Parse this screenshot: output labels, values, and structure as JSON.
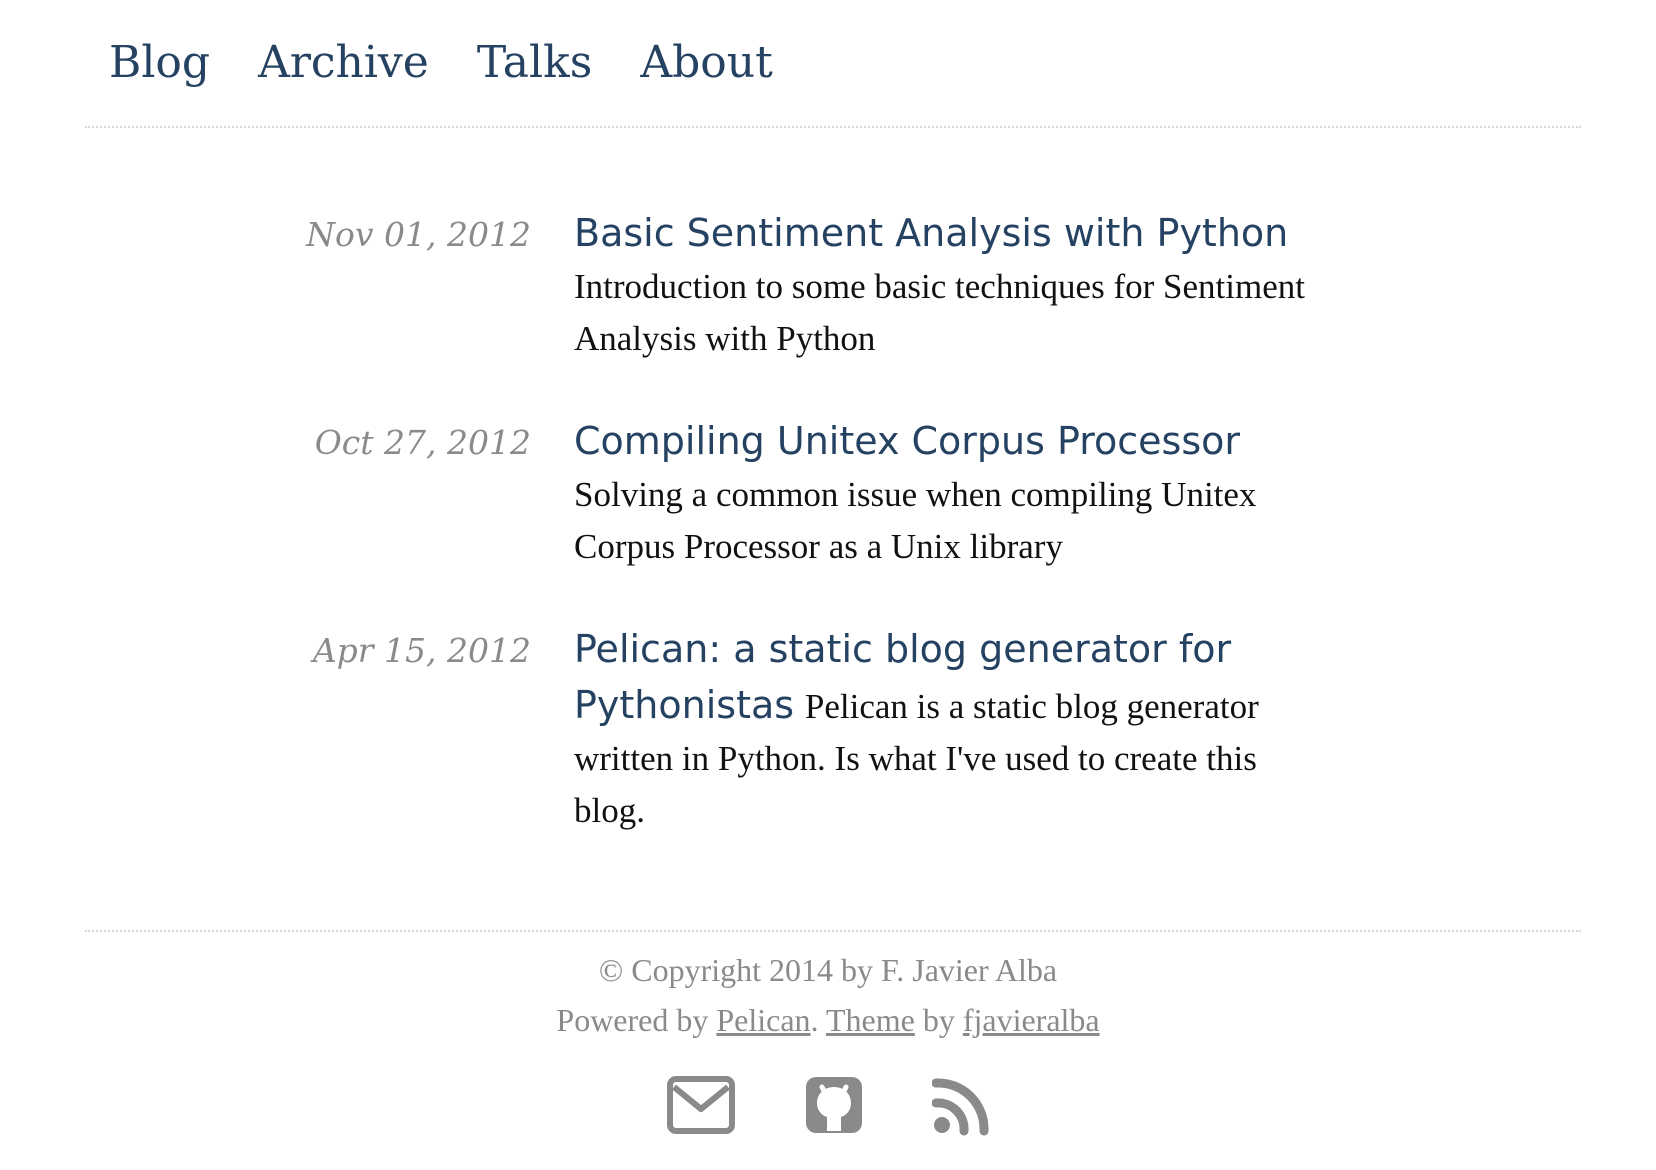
{
  "nav": {
    "items": [
      {
        "label": "Blog"
      },
      {
        "label": "Archive"
      },
      {
        "label": "Talks"
      },
      {
        "label": "About"
      }
    ]
  },
  "posts": [
    {
      "date": "Nov 01, 2012",
      "title": "Basic Sentiment Analysis with Python",
      "summary": "Introduction to some basic techniques for Sentiment Analysis with Python"
    },
    {
      "date": "Oct 27, 2012",
      "title": "Compiling Unitex Corpus Processor",
      "summary": "Solving a common issue when compiling Unitex Corpus Processor as a Unix library"
    },
    {
      "date": "Apr 15, 2012",
      "title": "Pelican: a static blog generator for Pythonistas",
      "summary": "Pelican is a static blog generator written in Python. Is what I've used to create this blog."
    }
  ],
  "footer": {
    "copyright": "© Copyright 2014 by F. Javier Alba",
    "powered_prefix": "Powered by ",
    "pelican_link": "Pelican",
    "sep": ". ",
    "theme_link": "Theme",
    "theme_by": " by ",
    "author_link": "fjavieralba",
    "icons": [
      "mail-icon",
      "github-icon",
      "rss-icon"
    ]
  },
  "colors": {
    "link": "#264262",
    "muted": "#8a8a8a",
    "text": "#111111"
  }
}
